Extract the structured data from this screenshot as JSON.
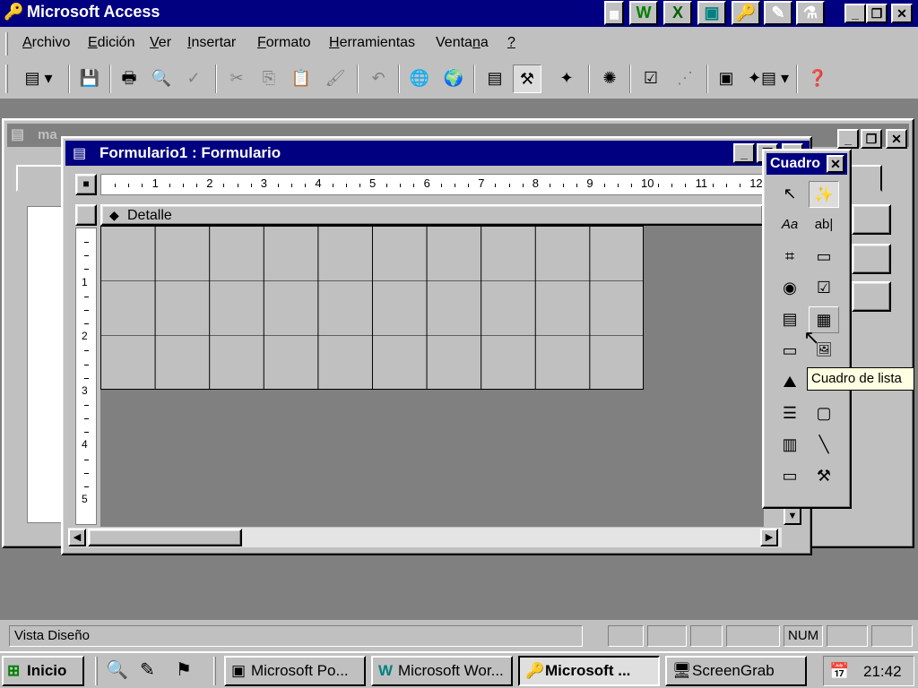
{
  "app": {
    "title": "Microsoft Access"
  },
  "titlebar": {
    "office_shortcuts": [
      "W",
      "X",
      "▣",
      "🔑",
      "✎",
      "⚗"
    ],
    "controls": [
      "_",
      "❐",
      "✕"
    ]
  },
  "menu": {
    "items": [
      {
        "label": "Archivo",
        "underline": "A",
        "rest": "rchivo"
      },
      {
        "label": "Edición",
        "underline": "E",
        "rest": "dición"
      },
      {
        "label": "Ver",
        "underline": "V",
        "rest": "er"
      },
      {
        "label": "Insertar",
        "underline": "I",
        "rest": "nsertar"
      },
      {
        "label": "Formato",
        "underline": "F",
        "rest": "ormato"
      },
      {
        "label": "Herramientas",
        "underline": "H",
        "rest": "erramientas"
      },
      {
        "label": "Ventana",
        "underline": "n",
        "pre": "Venta",
        "rest": "a"
      },
      {
        "label": "?",
        "underline": "?",
        "rest": ""
      }
    ]
  },
  "toolbar": {
    "icons": [
      "form-view-icon",
      "save-icon",
      "print-icon",
      "print-preview-icon",
      "spelling-icon",
      "cut-icon",
      "copy-icon",
      "paste-icon",
      "format-painter-icon",
      "undo-icon",
      "insert-hyperlink-icon",
      "web-toolbar-icon",
      "field-list-icon",
      "toolbox-icon",
      "autoformat-icon",
      "code-icon",
      "properties-icon",
      "build-icon",
      "database-window-icon",
      "new-object-icon",
      "help-icon"
    ]
  },
  "background_window": {
    "title": "ma"
  },
  "form_window": {
    "title": "Formulario1 : Formulario",
    "section": "Detalle",
    "ruler_numbers": [
      "1",
      "2",
      "3",
      "4",
      "5",
      "6",
      "7",
      "8",
      "9",
      "10",
      "11",
      "12"
    ],
    "vruler_numbers": [
      "1",
      "2",
      "3",
      "4",
      "5"
    ]
  },
  "toolbox": {
    "title": "Cuadro",
    "tools": [
      {
        "name": "select-objects-icon",
        "glyph": "↖"
      },
      {
        "name": "control-wizards-icon",
        "glyph": "✨"
      },
      {
        "name": "label-icon",
        "glyph": "Aa"
      },
      {
        "name": "textbox-icon",
        "glyph": "ab|"
      },
      {
        "name": "option-group-icon",
        "glyph": "⌗"
      },
      {
        "name": "toggle-button-icon",
        "glyph": "▭"
      },
      {
        "name": "option-button-icon",
        "glyph": "◉"
      },
      {
        "name": "checkbox-icon",
        "glyph": "☑"
      },
      {
        "name": "combo-box-icon",
        "glyph": "▤"
      },
      {
        "name": "list-box-icon",
        "glyph": "▦"
      },
      {
        "name": "command-button-icon",
        "glyph": "▭"
      },
      {
        "name": "image-icon",
        "glyph": "🖼"
      },
      {
        "name": "unbound-object-frame-icon",
        "glyph": "⛰"
      },
      {
        "name": "bound-object-frame-icon",
        "glyph": "▣"
      },
      {
        "name": "page-break-icon",
        "glyph": "☰"
      },
      {
        "name": "tab-control-icon",
        "glyph": "▢"
      },
      {
        "name": "subform-icon",
        "glyph": "▥"
      },
      {
        "name": "line-icon",
        "glyph": "╲"
      },
      {
        "name": "rectangle-icon",
        "glyph": "▭"
      },
      {
        "name": "more-controls-icon",
        "glyph": "⚒"
      }
    ]
  },
  "tooltip": {
    "text": "Cuadro de lista"
  },
  "statusbar": {
    "message": "Vista Diseño",
    "num": "NUM"
  },
  "taskbar": {
    "start": "Inicio",
    "buttons": [
      {
        "label": "Microsoft Po...",
        "icon": "powerpoint-icon"
      },
      {
        "label": "Microsoft Wor...",
        "icon": "word-icon"
      },
      {
        "label": "Microsoft ...",
        "icon": "access-icon",
        "active": true
      },
      {
        "label": "ScreenGrab",
        "icon": "screengrab-icon"
      }
    ],
    "clock": "21:42"
  }
}
